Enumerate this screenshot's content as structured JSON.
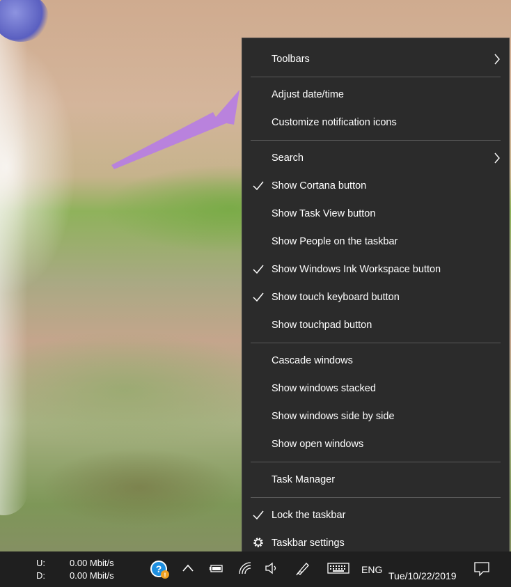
{
  "menu": {
    "items": [
      {
        "label": "Toolbars",
        "checked": false,
        "submenu": true
      },
      {
        "label": "Adjust date/time",
        "checked": false,
        "submenu": false
      },
      {
        "label": "Customize notification icons",
        "checked": false,
        "submenu": false
      },
      {
        "label": "Search",
        "checked": false,
        "submenu": true
      },
      {
        "label": "Show Cortana button",
        "checked": true,
        "submenu": false
      },
      {
        "label": "Show Task View button",
        "checked": false,
        "submenu": false
      },
      {
        "label": "Show People on the taskbar",
        "checked": false,
        "submenu": false
      },
      {
        "label": "Show Windows Ink Workspace button",
        "checked": true,
        "submenu": false
      },
      {
        "label": "Show touch keyboard button",
        "checked": true,
        "submenu": false
      },
      {
        "label": "Show touchpad button",
        "checked": false,
        "submenu": false
      },
      {
        "label": "Cascade windows",
        "checked": false,
        "submenu": false
      },
      {
        "label": "Show windows stacked",
        "checked": false,
        "submenu": false
      },
      {
        "label": "Show windows side by side",
        "checked": false,
        "submenu": false
      },
      {
        "label": "Show open windows",
        "checked": false,
        "submenu": false
      },
      {
        "label": "Task Manager",
        "checked": false,
        "submenu": false
      },
      {
        "label": "Lock the taskbar",
        "checked": true,
        "submenu": false
      },
      {
        "label": "Taskbar settings",
        "checked": false,
        "submenu": false,
        "icon": "gear-icon"
      }
    ]
  },
  "taskbar": {
    "upload_label": "U:",
    "upload_speed": "0.00 Mbit/s",
    "download_label": "D:",
    "download_speed": "0.00 Mbit/s",
    "language": "ENG",
    "date": "Tue/10/22/2019",
    "icons": [
      "help-warning-icon",
      "chevron-up-icon",
      "battery-icon",
      "wifi-icon",
      "volume-icon",
      "pen-icon",
      "keyboard-icon",
      "notification-icon"
    ]
  },
  "colors": {
    "menu_bg": "#2b2b2b",
    "taskbar_bg": "#1f1f1f",
    "arrow": "#b77fe0",
    "help_blue": "#1e8fe0",
    "warning_orange": "#f0a020"
  }
}
